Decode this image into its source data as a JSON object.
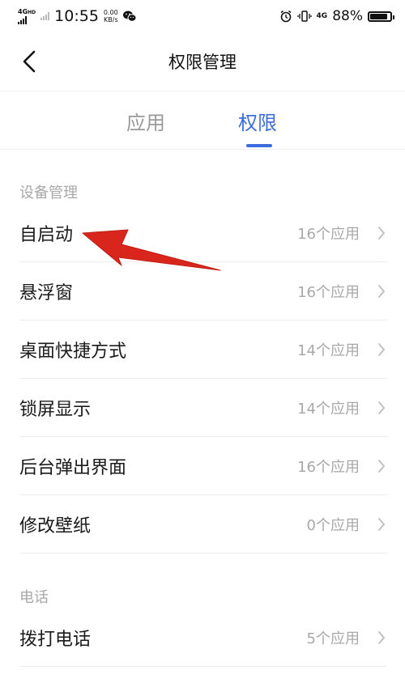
{
  "status_bar": {
    "network_type": "4G",
    "network_hd": "HD",
    "time": "10:55",
    "speed_value": "0.00",
    "speed_unit": "KB/s",
    "sim2_label": "4G",
    "battery_percent_text": "88%",
    "battery_level": 0.88,
    "icons": [
      "signal-icon",
      "wechat-icon",
      "alarm-icon",
      "vibrate-icon",
      "battery-icon"
    ]
  },
  "header": {
    "title": "权限管理",
    "back_icon": "chevron-left-icon"
  },
  "tabs": [
    {
      "label": "应用",
      "active": false
    },
    {
      "label": "权限",
      "active": true
    }
  ],
  "accent_color": "#3d6ddc",
  "sections": [
    {
      "header": "设备管理",
      "items": [
        {
          "label": "自启动",
          "count": "16个应用"
        },
        {
          "label": "悬浮窗",
          "count": "16个应用"
        },
        {
          "label": "桌面快捷方式",
          "count": "14个应用"
        },
        {
          "label": "锁屏显示",
          "count": "14个应用"
        },
        {
          "label": "后台弹出界面",
          "count": "16个应用"
        },
        {
          "label": "修改壁纸",
          "count": "0个应用"
        }
      ]
    },
    {
      "header": "电话",
      "items": [
        {
          "label": "拨打电话",
          "count": "5个应用"
        }
      ]
    }
  ],
  "annotation": {
    "type": "red-arrow",
    "color": "#d9261c",
    "points_to": "自启动"
  }
}
